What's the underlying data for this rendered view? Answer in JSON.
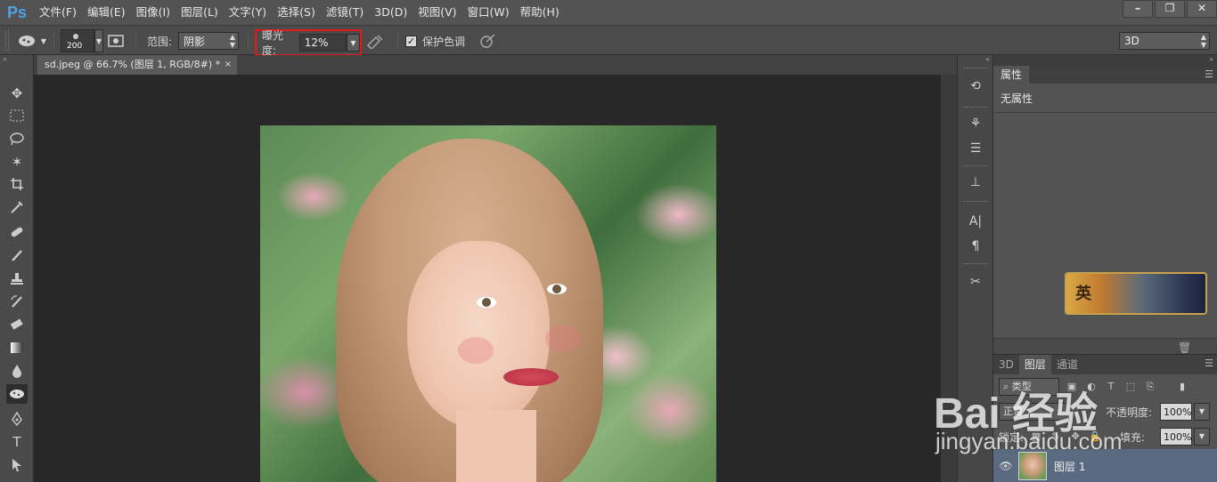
{
  "app": {
    "logo": "Ps",
    "menu": [
      "文件(F)",
      "编辑(E)",
      "图像(I)",
      "图层(L)",
      "文字(Y)",
      "选择(S)",
      "滤镜(T)",
      "3D(D)",
      "视图(V)",
      "窗口(W)",
      "帮助(H)"
    ]
  },
  "options": {
    "brush_size": "200",
    "range_label": "范围:",
    "range_value": "阴影",
    "exposure_label": "曝光度:",
    "exposure_value": "12%",
    "protect_tones_label": "保护色调",
    "protect_tones_checked": true,
    "workspace_value": "3D"
  },
  "document": {
    "tab_title": "sd.jpeg @ 66.7% (图层 1, RGB/8#) *",
    "close_glyph": "×"
  },
  "properties": {
    "tab_label": "属性",
    "empty_text": "无属性"
  },
  "ad": {
    "text": "英"
  },
  "layers_panel": {
    "tabs": [
      "3D",
      "图层",
      "通道"
    ],
    "kind_filter": "类型",
    "blend_mode": "正常",
    "opacity_label": "不透明度:",
    "opacity_value": "100%",
    "lock_label": "锁定:",
    "fill_label": "填充:",
    "fill_value": "100%",
    "layers": [
      {
        "name": "图层 1",
        "visible": true
      }
    ]
  },
  "watermark": {
    "brand": "Bai 经验",
    "url": "jingyan.baidu.com"
  }
}
